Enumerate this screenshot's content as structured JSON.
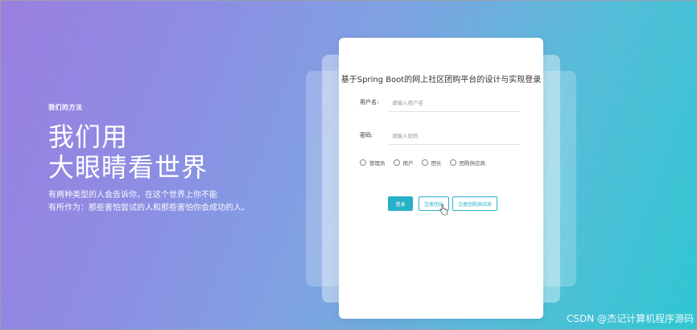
{
  "hero": {
    "kicker": "我们的方法",
    "headline_line1": "我们用",
    "headline_line2": "大眼睛看世界",
    "desc_line1": "有两种类型的人会告诉你，在这个世界上你不能",
    "desc_line2": "有所作为：那些害怕尝试的人和那些害怕你会成功的人。"
  },
  "login": {
    "title": "基于Spring Boot的网上社区团购平台的设计与实现登录",
    "username_label": "用户名:",
    "username_placeholder": "请输入用户名",
    "password_label": "密码:",
    "password_placeholder": "请输入密码",
    "roles": [
      "管理员",
      "用户",
      "团长",
      "团购供应商"
    ],
    "login_button": "登录",
    "register_leader_button": "注册团长",
    "register_supplier_button": "注册团购供应商"
  },
  "watermark": "CSDN @杰记计算机程序源码"
}
